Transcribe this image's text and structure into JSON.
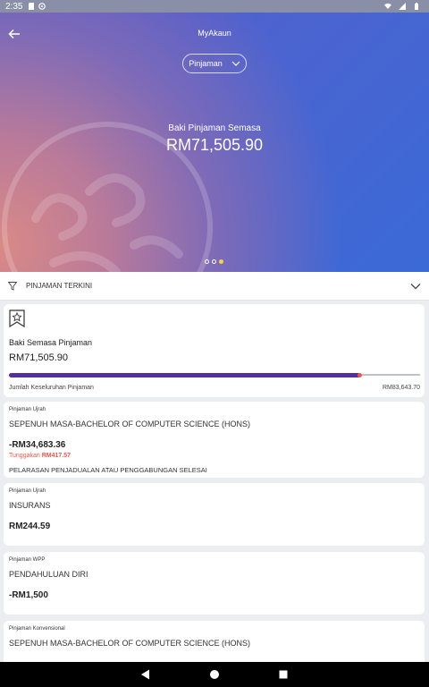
{
  "status_bar": {
    "time": "2:35"
  },
  "header": {
    "title": "MyAkaun",
    "dropdown_value": "Pinjaman"
  },
  "hero": {
    "balance_label": "Baki Pinjaman Semasa",
    "balance_value": "RM71,505.90",
    "pager": {
      "count": 3,
      "active_index": 2
    }
  },
  "filter": {
    "label": "PINJAMAN TERKINI"
  },
  "summary": {
    "label": "Baki Semasa Pinjaman",
    "value": "RM71,505.90",
    "total_label": "Jumlah Keseluruhan Pinjaman",
    "total_value": "RM83,643.70",
    "progress_fraction": 0.855
  },
  "loans": [
    {
      "type": "Pinjaman Ujrah",
      "name": "SEPENUH MASA-BACHELOR OF COMPUTER SCIENCE (HONS)",
      "amount": "-RM34,683.36",
      "arrears_label": "Tunggakan",
      "arrears_value": "RM417.57",
      "status": "PELARASAN PENJADUALAN ATAU PENGGABUNGAN SELESAI"
    },
    {
      "type": "Pinjaman Ujrah",
      "name": "INSURANS",
      "amount": "RM244.59"
    },
    {
      "type": "Pinjaman WPP",
      "name": "PENDAHULUAN DIRI",
      "amount": "-RM1,500"
    },
    {
      "type": "Pinjaman Konvensional",
      "name": "SEPENUH MASA-BACHELOR OF COMPUTER SCIENCE (HONS)"
    }
  ],
  "colors": {
    "progress_fill": "#55309a",
    "progress_cap": "#e25a4e",
    "arrears": "#e25a4e",
    "pager_active": "#f3d443"
  },
  "icons": {
    "back": "arrow-left-icon",
    "dropdown": "chevron-down-icon",
    "filter": "filter-icon",
    "bookmark": "bookmark-star-icon"
  }
}
